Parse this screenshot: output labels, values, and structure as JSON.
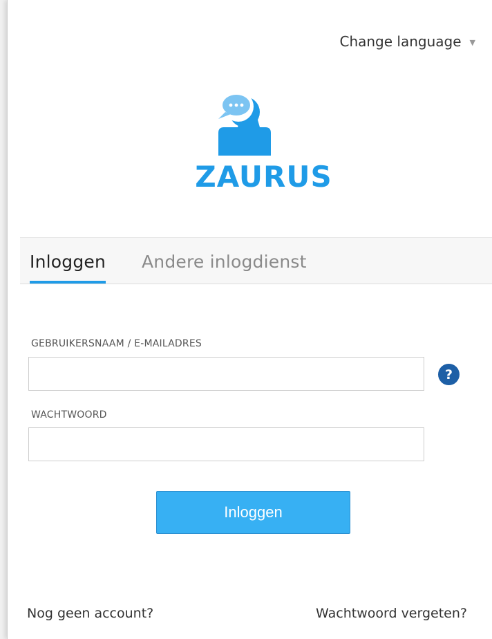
{
  "header": {
    "language_label": "Change language"
  },
  "logo": {
    "text": "ZAURUS",
    "color": "#1f9be7"
  },
  "tabs": [
    {
      "label": "Inloggen",
      "active": true
    },
    {
      "label": "Andere inlogdienst",
      "active": false
    }
  ],
  "form": {
    "username_label": "GEBRUIKERSNAAM / E-MAILADRES",
    "username_value": "",
    "password_label": "WACHTWOORD",
    "password_value": "",
    "help_icon": "?",
    "submit_label": "Inloggen"
  },
  "footer": {
    "signup_link": "Nog geen account?",
    "forgot_link": "Wachtwoord vergeten?"
  },
  "colors": {
    "accent": "#1f9be7",
    "button": "#37b0f3",
    "help_icon": "#1d5fa6"
  }
}
